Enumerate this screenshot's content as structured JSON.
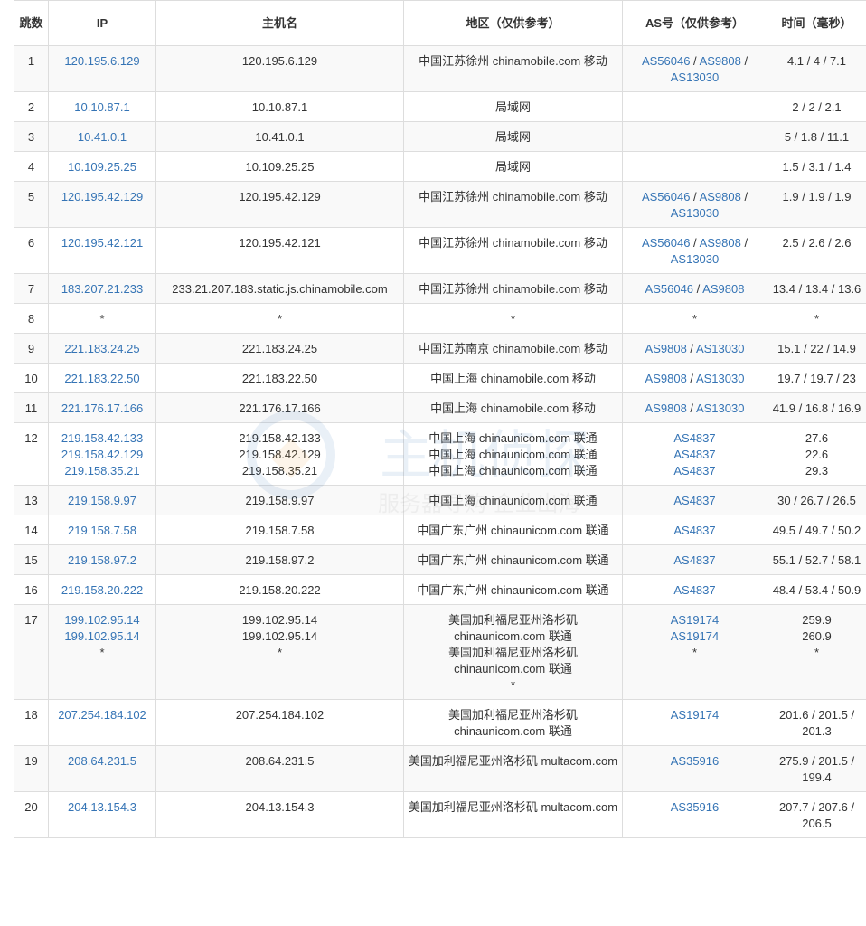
{
  "headers": {
    "hop": "跳数",
    "ip": "IP",
    "host": "主机名",
    "region": "地区（仅供参考）",
    "as": "AS号（仅供参考）",
    "time": "时间（毫秒）"
  },
  "rows": [
    {
      "hop": "1",
      "ips": [
        "120.195.6.129"
      ],
      "hosts": [
        "120.195.6.129"
      ],
      "regions": [
        "中国江苏徐州 chinamobile.com 移动"
      ],
      "as": [
        [
          "AS56046",
          "AS9808",
          "AS13030"
        ]
      ],
      "time": [
        "4.1 / 4 / 7.1"
      ]
    },
    {
      "hop": "2",
      "ips": [
        "10.10.87.1"
      ],
      "hosts": [
        "10.10.87.1"
      ],
      "regions": [
        "局域网"
      ],
      "as": [
        []
      ],
      "time": [
        "2 / 2 / 2.1"
      ]
    },
    {
      "hop": "3",
      "ips": [
        "10.41.0.1"
      ],
      "hosts": [
        "10.41.0.1"
      ],
      "regions": [
        "局域网"
      ],
      "as": [
        []
      ],
      "time": [
        "5 / 1.8 / 11.1"
      ]
    },
    {
      "hop": "4",
      "ips": [
        "10.109.25.25"
      ],
      "hosts": [
        "10.109.25.25"
      ],
      "regions": [
        "局域网"
      ],
      "as": [
        []
      ],
      "time": [
        "1.5 / 3.1 / 1.4"
      ]
    },
    {
      "hop": "5",
      "ips": [
        "120.195.42.129"
      ],
      "hosts": [
        "120.195.42.129"
      ],
      "regions": [
        "中国江苏徐州 chinamobile.com 移动"
      ],
      "as": [
        [
          "AS56046",
          "AS9808",
          "AS13030"
        ]
      ],
      "time": [
        "1.9 / 1.9 / 1.9"
      ]
    },
    {
      "hop": "6",
      "ips": [
        "120.195.42.121"
      ],
      "hosts": [
        "120.195.42.121"
      ],
      "regions": [
        "中国江苏徐州 chinamobile.com 移动"
      ],
      "as": [
        [
          "AS56046",
          "AS9808",
          "AS13030"
        ]
      ],
      "time": [
        "2.5 / 2.6 / 2.6"
      ]
    },
    {
      "hop": "7",
      "ips": [
        "183.207.21.233"
      ],
      "hosts": [
        "233.21.207.183.static.js.chinamobile.com"
      ],
      "regions": [
        "中国江苏徐州 chinamobile.com 移动"
      ],
      "as": [
        [
          "AS56046",
          "AS9808"
        ]
      ],
      "time": [
        "13.4 / 13.4 / 13.6"
      ]
    },
    {
      "hop": "8",
      "ips": [
        "*"
      ],
      "hosts": [
        "*"
      ],
      "regions": [
        "*"
      ],
      "as": [
        [
          "*"
        ]
      ],
      "time": [
        "*"
      ]
    },
    {
      "hop": "9",
      "ips": [
        "221.183.24.25"
      ],
      "hosts": [
        "221.183.24.25"
      ],
      "regions": [
        "中国江苏南京 chinamobile.com 移动"
      ],
      "as": [
        [
          "AS9808",
          "AS13030"
        ]
      ],
      "time": [
        "15.1 / 22 / 14.9"
      ]
    },
    {
      "hop": "10",
      "ips": [
        "221.183.22.50"
      ],
      "hosts": [
        "221.183.22.50"
      ],
      "regions": [
        "中国上海 chinamobile.com 移动"
      ],
      "as": [
        [
          "AS9808",
          "AS13030"
        ]
      ],
      "time": [
        "19.7 / 19.7 / 23"
      ]
    },
    {
      "hop": "11",
      "ips": [
        "221.176.17.166"
      ],
      "hosts": [
        "221.176.17.166"
      ],
      "regions": [
        "中国上海 chinamobile.com 移动"
      ],
      "as": [
        [
          "AS9808",
          "AS13030"
        ]
      ],
      "time": [
        "41.9 / 16.8 / 16.9"
      ]
    },
    {
      "hop": "12",
      "ips": [
        "219.158.42.133",
        "219.158.42.129",
        "219.158.35.21"
      ],
      "hosts": [
        "219.158.42.133",
        "219.158.42.129",
        "219.158.35.21"
      ],
      "regions": [
        "中国上海 chinaunicom.com 联通",
        "中国上海 chinaunicom.com 联通",
        "中国上海 chinaunicom.com 联通"
      ],
      "as": [
        [
          "AS4837"
        ],
        [
          "AS4837"
        ],
        [
          "AS4837"
        ]
      ],
      "time": [
        "27.6",
        "22.6",
        "29.3"
      ]
    },
    {
      "hop": "13",
      "ips": [
        "219.158.9.97"
      ],
      "hosts": [
        "219.158.9.97"
      ],
      "regions": [
        "中国上海 chinaunicom.com 联通"
      ],
      "as": [
        [
          "AS4837"
        ]
      ],
      "time": [
        "30 / 26.7 / 26.5"
      ]
    },
    {
      "hop": "14",
      "ips": [
        "219.158.7.58"
      ],
      "hosts": [
        "219.158.7.58"
      ],
      "regions": [
        "中国广东广州 chinaunicom.com 联通"
      ],
      "as": [
        [
          "AS4837"
        ]
      ],
      "time": [
        "49.5 / 49.7 / 50.2"
      ]
    },
    {
      "hop": "15",
      "ips": [
        "219.158.97.2"
      ],
      "hosts": [
        "219.158.97.2"
      ],
      "regions": [
        "中国广东广州 chinaunicom.com 联通"
      ],
      "as": [
        [
          "AS4837"
        ]
      ],
      "time": [
        "55.1 / 52.7 / 58.1"
      ]
    },
    {
      "hop": "16",
      "ips": [
        "219.158.20.222"
      ],
      "hosts": [
        "219.158.20.222"
      ],
      "regions": [
        "中国广东广州 chinaunicom.com 联通"
      ],
      "as": [
        [
          "AS4837"
        ]
      ],
      "time": [
        "48.4 / 53.4 / 50.9"
      ]
    },
    {
      "hop": "17",
      "ips": [
        "199.102.95.14",
        "199.102.95.14",
        "*"
      ],
      "hosts": [
        "199.102.95.14",
        "199.102.95.14",
        "*"
      ],
      "regions": [
        "美国加利福尼亚州洛杉矶 chinaunicom.com 联通",
        "美国加利福尼亚州洛杉矶 chinaunicom.com 联通",
        "*"
      ],
      "as": [
        [
          "AS19174"
        ],
        [
          "AS19174"
        ],
        [
          "*"
        ]
      ],
      "time": [
        "259.9",
        "260.9",
        "*"
      ]
    },
    {
      "hop": "18",
      "ips": [
        "207.254.184.102"
      ],
      "hosts": [
        "207.254.184.102"
      ],
      "regions": [
        "美国加利福尼亚州洛杉矶 chinaunicom.com 联通"
      ],
      "as": [
        [
          "AS19174"
        ]
      ],
      "time": [
        "201.6 / 201.5 / 201.3"
      ]
    },
    {
      "hop": "19",
      "ips": [
        "208.64.231.5"
      ],
      "hosts": [
        "208.64.231.5"
      ],
      "regions": [
        "美国加利福尼亚州洛杉矶 multacom.com"
      ],
      "as": [
        [
          "AS35916"
        ]
      ],
      "time": [
        "275.9 / 201.5 / 199.4"
      ]
    },
    {
      "hop": "20",
      "ips": [
        "204.13.154.3"
      ],
      "hosts": [
        "204.13.154.3"
      ],
      "regions": [
        "美国加利福尼亚州洛杉矶 multacom.com"
      ],
      "as": [
        [
          "AS35916"
        ]
      ],
      "time": [
        "207.7 / 207.6 / 206.5"
      ]
    }
  ],
  "watermark": {
    "brand": "主机侦探",
    "slogan": "服务器导购 企业出海"
  },
  "colors": {
    "link": "#3574b5",
    "border": "#dddddd",
    "stripe": "#f9f9f9"
  }
}
